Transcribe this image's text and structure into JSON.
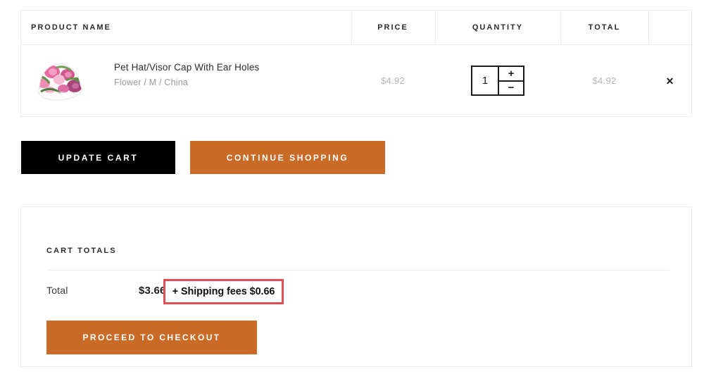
{
  "table": {
    "headers": {
      "product": "PRODUCT NAME",
      "price": "PRICE",
      "quantity": "QUANTITY",
      "total": "TOTAL"
    },
    "row": {
      "product_name": "Pet Hat/Visor Cap With Ear Holes",
      "variant": "Flower / M / China",
      "price": "$4.92",
      "quantity": "1",
      "total": "$4.92",
      "increment_label": "+",
      "decrement_label": "−",
      "remove_label": "✕",
      "thumbnail_icon": "floral-visor-cap-image"
    }
  },
  "actions": {
    "update_cart": "UPDATE CART",
    "continue_shopping": "CONTINUE SHOPPING"
  },
  "cart_totals": {
    "heading": "CART TOTALS",
    "total_label": "Total",
    "total_value": "$3.66",
    "checkout_label": "PROCEED TO CHECKOUT"
  },
  "annotation": {
    "text": "+ Shipping fees $0.66",
    "border_color": "#e04b54"
  },
  "colors": {
    "accent_orange": "#c96a26",
    "dark_button": "#000000",
    "annotation_red": "#e04b54",
    "muted_text": "#b4b4b4",
    "border": "#ececec"
  }
}
